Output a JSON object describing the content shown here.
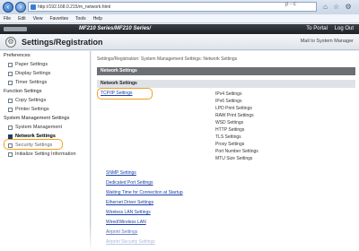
{
  "browser": {
    "url": "http://192.168.0.215/m_network.html",
    "url_tools": "ρ ‑ c",
    "chrome_icons": "⌂ ☆ ⚙",
    "menu": [
      "File",
      "Edit",
      "View",
      "Favorites",
      "Tools",
      "Help"
    ]
  },
  "device": {
    "model": "MF210 Series/MF210 Series/",
    "links": [
      "To Portal",
      "Log Out"
    ]
  },
  "title": {
    "text": "Settings/Registration",
    "mail": "Mail to System Manager"
  },
  "sidebar": {
    "groups": [
      {
        "label": "Preferences",
        "items": [
          "Paper Settings",
          "Display Settings",
          "Timer Settings"
        ]
      },
      {
        "label": "Function Settings",
        "items": [
          "Copy Settings",
          "Printer Settings"
        ]
      },
      {
        "label": "System Management Settings",
        "items": [
          "System Management",
          "Network Settings",
          "Security Settings",
          "Initialize Setting Information"
        ]
      }
    ],
    "active_item": "Network Settings"
  },
  "main": {
    "breadcrumb": "Settings/Registration: System Management Settings: Network Settings",
    "section_title": "Network Settings",
    "subsection_title": "Network Settings",
    "tcpip_link": "TCP/IP Settings",
    "tcpip_sublist": [
      "IPv4 Settings",
      "IPv6 Settings",
      "LPD Print Settings",
      "RAW Print Settings",
      "WSD Settings",
      "HTTP Settings",
      "TLS Settings",
      "Proxy Settings",
      "Port Number Settings",
      "MTU Size Settings"
    ],
    "other_links": [
      "SNMP Settings",
      "Dedicated Port Settings",
      "Waiting Time for Connection at Startup",
      "Ethernet Driver Settings",
      "Wireless LAN Settings",
      "Wired/Wireless LAN",
      "Airprint Settings",
      "Airprint Security Settings"
    ]
  },
  "colors": {
    "highlight": "#f0a020",
    "link": "#1a3fa8",
    "header_dark": "#1f2226"
  }
}
